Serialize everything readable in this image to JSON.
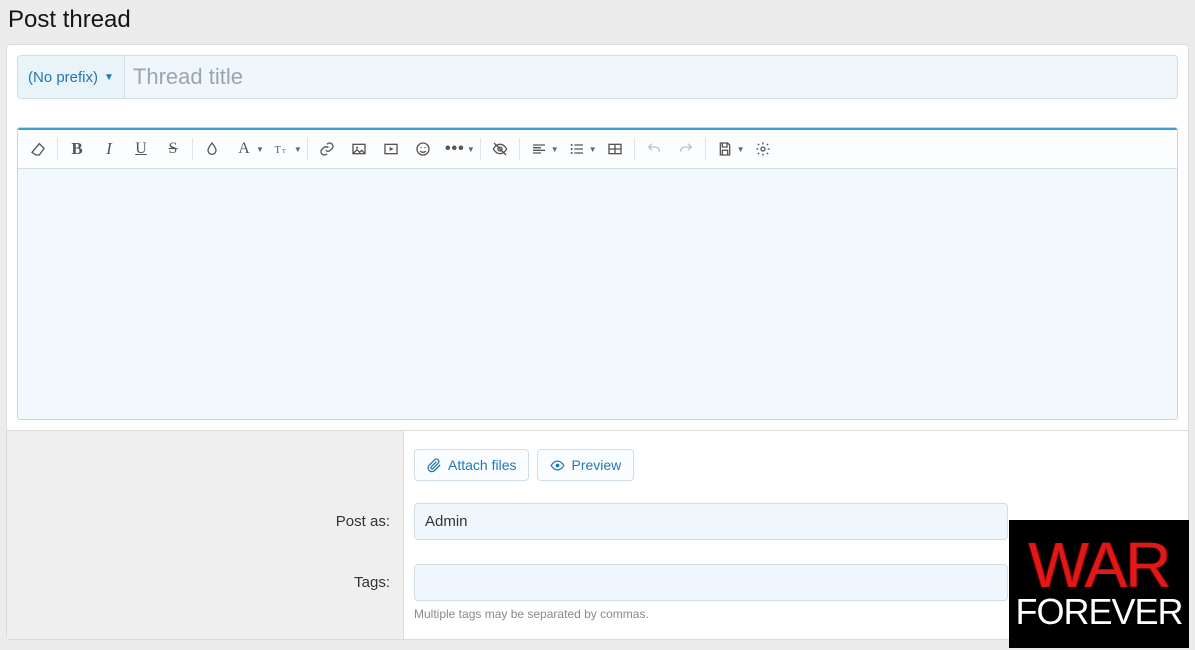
{
  "page": {
    "title": "Post thread"
  },
  "thread": {
    "prefix_label": "(No prefix)",
    "title_placeholder": "Thread title",
    "title_value": ""
  },
  "toolbar": {
    "items": [
      "remove-formatting",
      "sep",
      "bold",
      "italic",
      "underline",
      "strike",
      "sep",
      "text-color",
      "font-family",
      "font-size",
      "sep",
      "insert-link",
      "insert-image",
      "insert-media",
      "smilie",
      "more-dots",
      "sep",
      "spoiler",
      "sep",
      "align",
      "list",
      "table",
      "sep",
      "undo",
      "redo",
      "sep",
      "drafts",
      "settings"
    ]
  },
  "actions": {
    "attach_label": "Attach files",
    "preview_label": "Preview"
  },
  "form": {
    "post_as_label": "Post as:",
    "post_as_value": "Admin",
    "tags_label": "Tags:",
    "tags_value": "",
    "tags_hint": "Multiple tags may be separated by commas."
  },
  "logo": {
    "line1": "WAR",
    "line2": "FOREVER"
  }
}
